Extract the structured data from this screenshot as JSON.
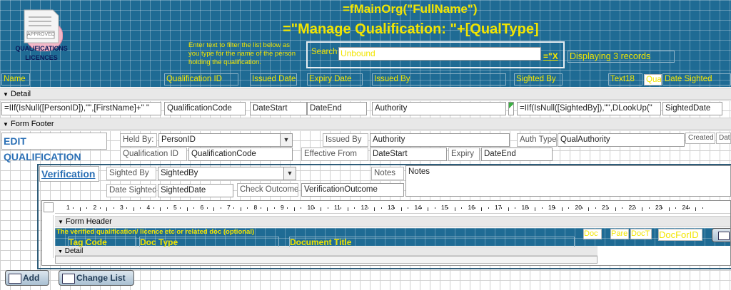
{
  "header": {
    "logo_stamp": "APPROVED",
    "logo_caption_1": "QUALIFICATIONS",
    "logo_caption_2": "LICENCES",
    "expr_org": "=fMainOrg(\"FullName\")",
    "expr_title": "=\"Manage Qualification: \"+[QualType]",
    "filter_hint": "Enter text to filter the list below as you type for the name of the person holding the qualification.",
    "search_label": "Search",
    "search_value": "Unbound",
    "clear_button": "=\"X",
    "record_count": "Displaying 3 records",
    "columns": [
      "Name",
      "Qualification ID",
      "Issued Date",
      "Expiry Date",
      "Issued By",
      "Sighted By",
      "Text18",
      "Qua",
      "Date Sighted"
    ]
  },
  "detail": {
    "band_label": "Detail",
    "fields": [
      "=IIf(IsNull([PersonID]),\"\",[FirstName]+\" \"",
      "QualificationCode",
      "DateStart",
      "DateEnd",
      "Authority",
      "=IIf(IsNull([SightedBy]),\"\",DLookUp(\"",
      "SightedDate"
    ]
  },
  "footer": {
    "band_label": "Form Footer",
    "edit_title": "EDIT QUALIFICATION",
    "held_by_label": "Held By:",
    "held_by_value": "PersonID",
    "issued_by_label": "Issued By",
    "issued_by_value": "Authority",
    "auth_type_label": "Auth Type",
    "auth_type_value": "QualAuthority",
    "created_label": "Created",
    "date_label": "Dat",
    "qual_id_label": "Qualification ID",
    "qual_id_value": "QualificationCode",
    "effective_label": "Effective From",
    "effective_value": "DateStart",
    "expiry_label": "Expiry",
    "expiry_value": "DateEnd",
    "verification_title": "Verification",
    "sighted_by_label": "Sighted By",
    "sighted_by_value": "SightedBy",
    "notes_label": "Notes",
    "notes_value": "Notes",
    "date_sighted_label": "Date Sighted",
    "date_sighted_value": "SightedDate",
    "check_outcome_label": "Check Outcome",
    "check_outcome_value": "VerificationOutcome"
  },
  "subform": {
    "ruler_numbers": [
      "1",
      "2",
      "3",
      "4",
      "5",
      "6",
      "7",
      "8",
      "9",
      "10",
      "11",
      "12",
      "13",
      "14",
      "15",
      "16",
      "17",
      "18",
      "19",
      "20",
      "21",
      "22",
      "23",
      "24"
    ],
    "header_band": "Form Header",
    "note": "The verified qualification/ licence etc or related doc (optional)",
    "col_tag": "Tag Code",
    "col_doctype": "Doc Type",
    "col_title": "Document Title",
    "chips": [
      "Doc",
      "Pare",
      "DocT",
      "DocForID"
    ],
    "detail_band": "Detail"
  },
  "buttons": {
    "add": "Add",
    "change_list": "Change List"
  },
  "colors": {
    "header_bg": "#1f6b94",
    "header_text": "#f2e500",
    "title_blue": "#2a6fb5"
  }
}
